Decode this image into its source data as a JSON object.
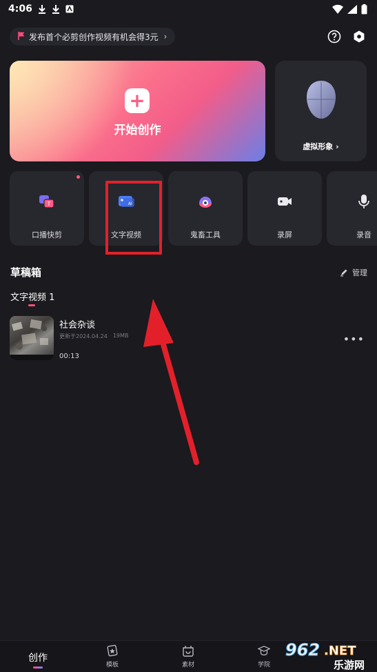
{
  "status_bar": {
    "time": "4:06"
  },
  "promo": {
    "text": "发布首个必剪创作视频有机会得3元",
    "chevron": "›"
  },
  "header_icons": {
    "help": "help-icon",
    "settings": "settings-icon"
  },
  "start_card": {
    "label": "开始创作",
    "plus": "+"
  },
  "avatar_card": {
    "label": "虚拟形象 ›"
  },
  "tools": [
    {
      "label": "口播快剪",
      "icon": "teleprompter-icon"
    },
    {
      "label": "文字视频",
      "icon": "text-video-icon"
    },
    {
      "label": "鬼畜工具",
      "icon": "remix-tool-icon"
    },
    {
      "label": "录屏",
      "icon": "screen-record-icon"
    },
    {
      "label": "录音",
      "icon": "microphone-icon"
    }
  ],
  "drafts": {
    "title": "草稿箱",
    "manage": "管理",
    "tab": "文字视频 1",
    "items": [
      {
        "name": "社会杂谈",
        "updated": "更新于2024.04.24",
        "size": "19MB",
        "duration": "00:13",
        "more": "•••"
      }
    ]
  },
  "bottom_nav": [
    {
      "label": "创作",
      "active": true
    },
    {
      "label": "模板"
    },
    {
      "label": "素材"
    },
    {
      "label": "学院"
    }
  ],
  "watermark": {
    "brand": "962.NET",
    "sub": "乐游网"
  },
  "colors": {
    "accent": "#ff4d7a",
    "background": "#1a1a1f",
    "card": "#27272e",
    "annotation": "#e3202a"
  }
}
